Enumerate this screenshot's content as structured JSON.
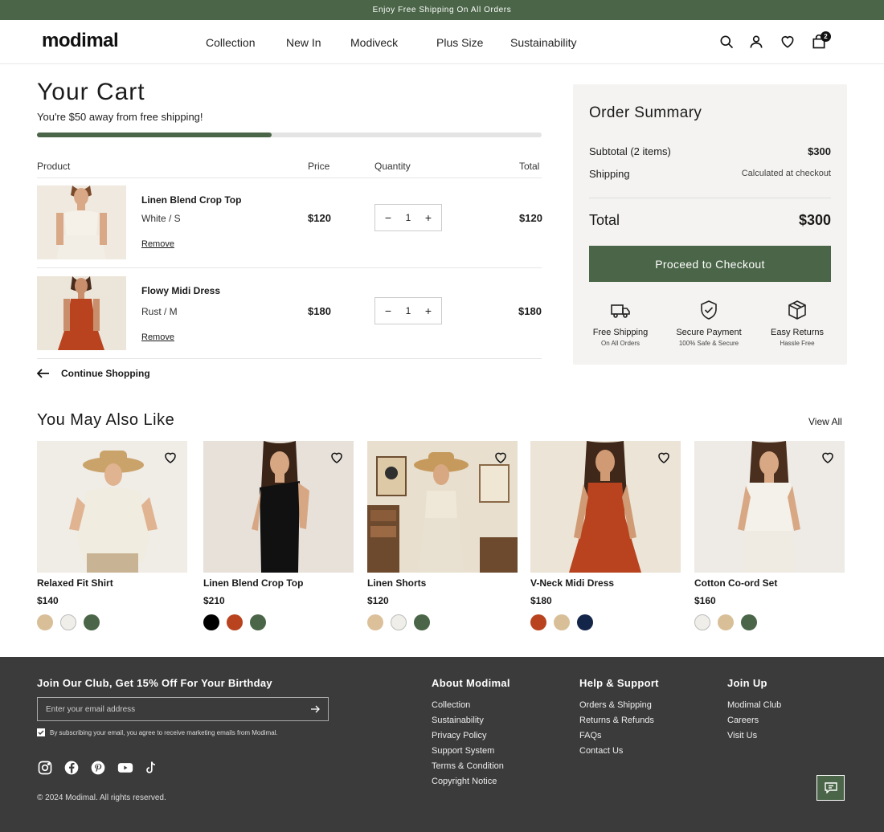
{
  "announcement": "Enjoy Free Shipping On All Orders",
  "header": {
    "logo": "modimal",
    "nav": [
      "Collection",
      "New In",
      "Modiveck",
      "Plus Size",
      "Sustainability"
    ],
    "cart_count": "2"
  },
  "cart": {
    "title": "Your Cart",
    "shipping_message": "You're $50 away from free shipping!",
    "shipping_progress": 0.465,
    "columns": {
      "product": "Product",
      "price": "Price",
      "quantity": "Quantity",
      "total": "Total"
    },
    "items": [
      {
        "name": "Linen Blend Crop Top",
        "variant": "White / S",
        "remove": "Remove",
        "price": "$120",
        "qty": "1",
        "total": "$120"
      },
      {
        "name": "Flowy Midi Dress",
        "variant": "Rust / M",
        "remove": "Remove",
        "price": "$180",
        "qty": "1",
        "total": "$180"
      }
    ],
    "continue": "Continue Shopping"
  },
  "summary": {
    "title": "Order Summary",
    "subtotal_label": "Subtotal (2 items)",
    "subtotal_value": "$300",
    "shipping_label": "Shipping",
    "shipping_value": "Calculated at checkout",
    "total_label": "Total",
    "total_value": "$300",
    "checkout_label": "Proceed to Checkout",
    "features": [
      {
        "icon": "truck-icon",
        "title": "Free Shipping",
        "sub": "On All Orders"
      },
      {
        "icon": "shield-check-icon",
        "title": "Secure Payment",
        "sub": "100% Safe & Secure"
      },
      {
        "icon": "package-icon",
        "title": "Easy Returns",
        "sub": "Hassle Free"
      }
    ]
  },
  "recommendations": {
    "title": "You May Also Like",
    "view_all": "View All",
    "products": [
      {
        "name": "Relaxed Fit Shirt",
        "price": "$140",
        "swatches": [
          "#d8bf98",
          "#f0eee8",
          "#4a6547"
        ]
      },
      {
        "name": "Linen Blend Crop Top",
        "price": "$210",
        "swatches": [
          "#000000",
          "#b8431e",
          "#4a6547"
        ]
      },
      {
        "name": "Linen Shorts",
        "price": "$120",
        "swatches": [
          "#dcc09a",
          "#efeee8",
          "#4a6547"
        ]
      },
      {
        "name": "V-Neck Midi Dress",
        "price": "$180",
        "swatches": [
          "#b8431e",
          "#d8bf98",
          "#14254a"
        ]
      },
      {
        "name": "Cotton Co-ord Set",
        "price": "$160",
        "swatches": [
          "#efeee8",
          "#d8bf98",
          "#4a6547"
        ]
      }
    ]
  },
  "footer": {
    "club_heading": "Join Our Club, Get 15% Off For Your Birthday",
    "email_placeholder": "Enter your email address",
    "consent": "By subscribing your email, you agree to receive marketing emails from Modimal.",
    "columns": [
      {
        "heading": "About Modimal",
        "links": [
          "Collection",
          "Sustainability",
          "Privacy Policy",
          "Support System",
          "Terms & Condition",
          "Copyright Notice"
        ]
      },
      {
        "heading": "Help & Support",
        "links": [
          "Orders & Shipping",
          "Returns & Refunds",
          "FAQs",
          "Contact Us"
        ]
      },
      {
        "heading": "Join Up",
        "links": [
          "Modimal Club",
          "Careers",
          "Visit Us"
        ]
      }
    ],
    "social": [
      "instagram-icon",
      "facebook-icon",
      "pinterest-icon",
      "youtube-icon",
      "tiktok-icon"
    ],
    "copyright": "© 2024 Modimal. All rights reserved."
  },
  "colors": {
    "brand_green": "#4a6547",
    "footer_bg": "#3b3b3b",
    "summary_bg": "#f4f3f1"
  }
}
